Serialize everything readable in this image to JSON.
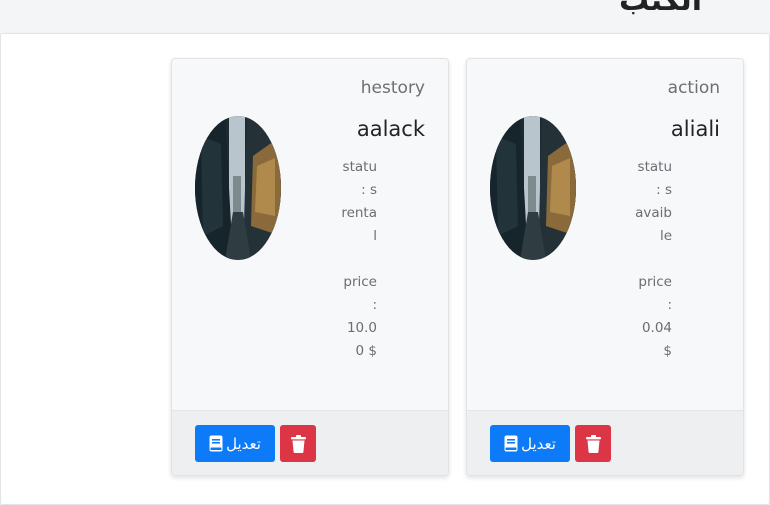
{
  "page": {
    "heading": "الكتب"
  },
  "cards": [
    {
      "category": "hestory",
      "title": "aalack",
      "status_label": "status :",
      "status_value": "rental",
      "price_label": "price :",
      "price_value": "10.0$ 0",
      "edit_label": "تعديل",
      "image_icon": "book-cover-image",
      "edit_icon": "book-icon",
      "delete_icon": "trash-icon"
    },
    {
      "category": "action",
      "title": "aliali",
      "status_label": "status :",
      "status_value": "avaible",
      "price_label": "price :",
      "price_value": "0.04$",
      "edit_label": "تعديل",
      "image_icon": "book-cover-image",
      "edit_icon": "book-icon",
      "delete_icon": "trash-icon"
    }
  ],
  "colors": {
    "edit_button": "#0d7bf7",
    "delete_button": "#dc3545",
    "card_background": "#f7f8fa",
    "footer_background": "#eeeff1"
  }
}
